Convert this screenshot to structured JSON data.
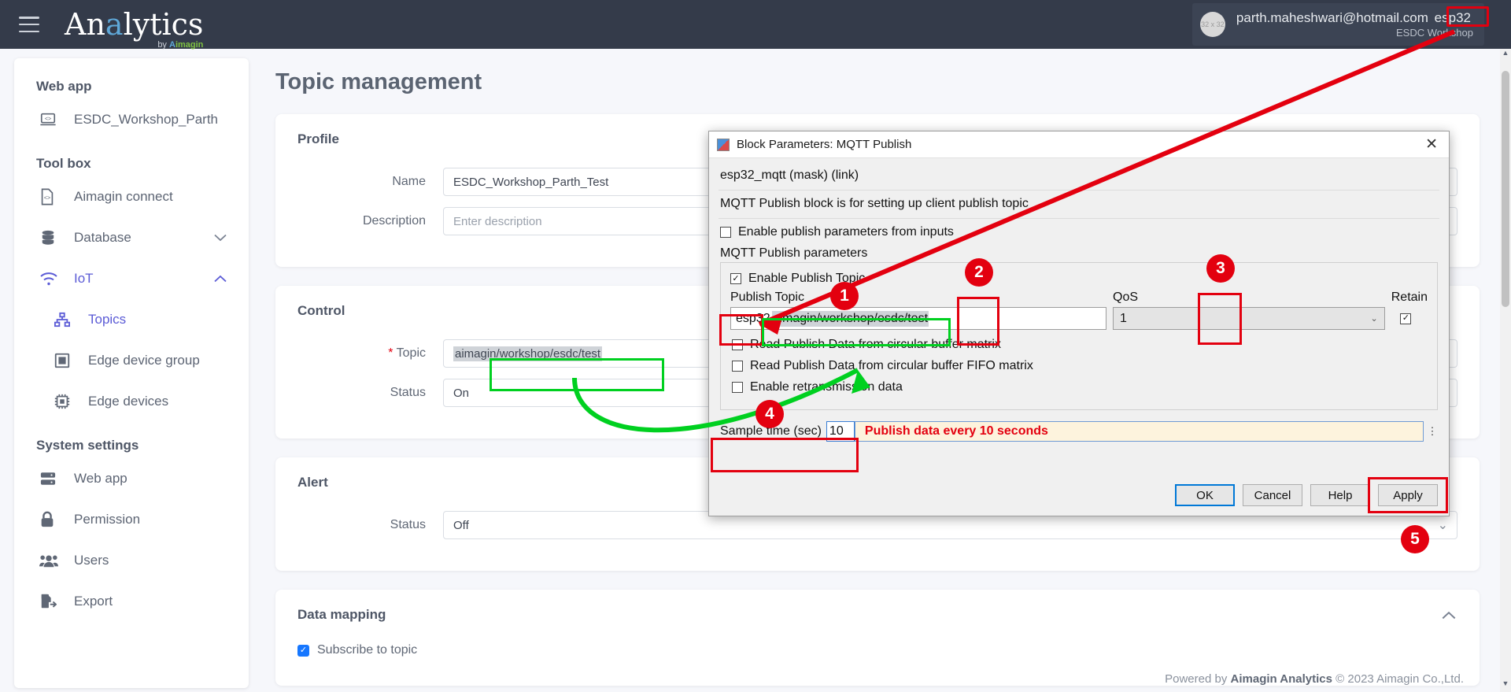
{
  "header": {
    "brand_main": "An",
    "brand_highlight": "a",
    "brand_rest": "lytics",
    "brand_sub_prefix": "by ",
    "brand_sub_name": "Aimagin",
    "avatar_label": "32 x 32",
    "user_email": "parth.maheshwari@hotmail.com",
    "user_tag": "esp32",
    "user_org": "ESDC Workshop",
    "menu_icon": "hamburger-icon"
  },
  "sidebar": {
    "groups": [
      {
        "title": "Web app",
        "items": [
          {
            "label": "ESDC_Workshop_Parth",
            "icon": "webapp-code-icon",
            "active": false,
            "sub": false,
            "chevron": ""
          }
        ]
      },
      {
        "title": "Tool box",
        "items": [
          {
            "label": "Aimagin connect",
            "icon": "file-code-icon",
            "active": false,
            "sub": false,
            "chevron": ""
          },
          {
            "label": "Database",
            "icon": "database-icon",
            "active": false,
            "sub": false,
            "chevron": "chevron-down-icon"
          },
          {
            "label": "IoT",
            "icon": "wifi-icon",
            "active": true,
            "sub": false,
            "chevron": "chevron-up-icon"
          },
          {
            "label": "Topics",
            "icon": "sitemap-icon",
            "active": true,
            "sub": true,
            "chevron": ""
          },
          {
            "label": "Edge device group",
            "icon": "device-group-icon",
            "active": false,
            "sub": true,
            "chevron": ""
          },
          {
            "label": "Edge devices",
            "icon": "chip-icon",
            "active": false,
            "sub": true,
            "chevron": ""
          }
        ]
      },
      {
        "title": "System settings",
        "items": [
          {
            "label": "Web app",
            "icon": "server-icon",
            "active": false,
            "sub": false,
            "chevron": ""
          },
          {
            "label": "Permission",
            "icon": "lock-icon",
            "active": false,
            "sub": false,
            "chevron": ""
          },
          {
            "label": "Users",
            "icon": "users-icon",
            "active": false,
            "sub": false,
            "chevron": ""
          },
          {
            "label": "Export",
            "icon": "export-icon",
            "active": false,
            "sub": false,
            "chevron": ""
          }
        ]
      }
    ]
  },
  "main": {
    "page_title": "Topic management",
    "profile": {
      "heading": "Profile",
      "name_label": "Name",
      "name_value": "ESDC_Workshop_Parth_Test",
      "description_label": "Description",
      "description_placeholder": "Enter description"
    },
    "control": {
      "heading": "Control",
      "topic_label": "Topic",
      "topic_required": "*",
      "topic_value": "aimagin/workshop/esdc/test",
      "status_label": "Status",
      "status_value": "On"
    },
    "alert": {
      "heading": "Alert",
      "status_label": "Status",
      "status_value": "Off"
    },
    "data_mapping": {
      "heading": "Data mapping",
      "subscribe_label": "Subscribe to topic",
      "subscribe_checked": true
    },
    "footer_prefix": "Powered by ",
    "footer_brand": "Aimagin Analytics",
    "footer_suffix": " © 2023 Aimagin Co.,Ltd."
  },
  "dialog": {
    "title": "Block Parameters: MQTT Publish",
    "close_label": "✕",
    "block_name": "esp32_mqtt (mask) (link)",
    "block_desc": "MQTT Publish block is for setting up client publish topic",
    "enable_inputs_label": "Enable publish parameters from inputs",
    "enable_inputs_checked": false,
    "params_heading": "MQTT Publish parameters",
    "enable_publish_topic_label": "Enable Publish Topic",
    "enable_publish_topic_checked": true,
    "publish_topic_label": "Publish Topic",
    "publish_topic_prefix": "esp32",
    "publish_topic_value": "aimagin/workshop/esdc/test",
    "qos_label": "QoS",
    "qos_value": "1",
    "retain_label": "Retain",
    "retain_checked": true,
    "checkboxes": [
      {
        "label": "Read Publish Data from circular buffer matrix",
        "checked": false
      },
      {
        "label": "Read Publish Data from circular buffer FIFO matrix",
        "checked": false
      },
      {
        "label": "Enable retransmission data",
        "checked": false
      }
    ],
    "sample_time_label": "Sample time (sec)",
    "sample_time_value": "10",
    "sample_time_note": "Publish data every 10 seconds",
    "buttons": {
      "ok": "OK",
      "cancel": "Cancel",
      "help": "Help",
      "apply": "Apply"
    }
  },
  "annotations": {
    "badges": [
      "1",
      "2",
      "3",
      "4",
      "5"
    ],
    "red_color": "#e3000f",
    "green_color": "#00d020",
    "note_bg": "#fdf3dd"
  }
}
